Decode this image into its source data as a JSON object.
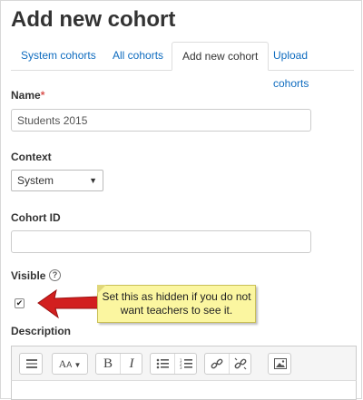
{
  "page": {
    "title": "Add new cohort"
  },
  "tabs": [
    {
      "label": "System cohorts"
    },
    {
      "label": "All cohorts"
    },
    {
      "label": "Add new cohort"
    },
    {
      "label": "Upload cohorts"
    }
  ],
  "form": {
    "name": {
      "label": "Name",
      "required_mark": "*",
      "value": "Students 2015"
    },
    "context": {
      "label": "Context",
      "selected": "System",
      "caret": "▼"
    },
    "cohort_id": {
      "label": "Cohort ID",
      "value": ""
    },
    "visible": {
      "label": "Visible",
      "help": "?",
      "checked": true,
      "check_glyph": "✔"
    },
    "description": {
      "label": "Description"
    }
  },
  "callout": {
    "line1": "Set this as hidden if you do not",
    "line2": "want teachers to see it.",
    "color": "#fbf6a0",
    "arrow_color": "#d21f1f"
  },
  "toolbar": {
    "font_label": "A",
    "font_sub": "A",
    "bold": "B",
    "italic": "I",
    "icons": [
      "toolbar-toggle-icon",
      "font-style-icon",
      "bold-icon",
      "italic-icon",
      "unordered-list-icon",
      "ordered-list-icon",
      "link-icon",
      "unlink-icon",
      "image-icon"
    ]
  },
  "colors": {
    "link": "#0f6cbf",
    "required": "#d9534f"
  }
}
